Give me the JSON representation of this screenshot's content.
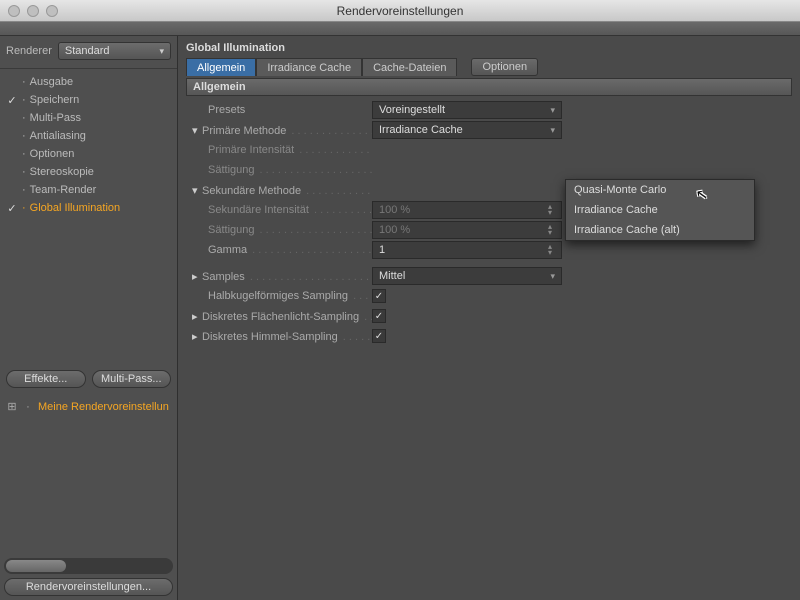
{
  "window": {
    "title": "Rendervoreinstellungen"
  },
  "sidebar": {
    "renderer_label": "Renderer",
    "renderer_value": "Standard",
    "items": [
      {
        "label": "Ausgabe",
        "checked": "",
        "indent": 0,
        "active": false,
        "dim": false
      },
      {
        "label": "Speichern",
        "checked": "✓",
        "indent": 0,
        "active": false,
        "dim": false
      },
      {
        "label": "Multi-Pass",
        "checked": "",
        "indent": 0,
        "active": false,
        "dim": false
      },
      {
        "label": "Antialiasing",
        "checked": "",
        "indent": 0,
        "active": false,
        "dim": false
      },
      {
        "label": "Optionen",
        "checked": "",
        "indent": 0,
        "active": false,
        "dim": false
      },
      {
        "label": "Stereoskopie",
        "checked": "",
        "indent": 0,
        "active": false,
        "dim": false
      },
      {
        "label": "Team-Render",
        "checked": "",
        "indent": 0,
        "active": false,
        "dim": false
      },
      {
        "label": "Global Illumination",
        "checked": "✓",
        "indent": 0,
        "active": true,
        "dim": false
      }
    ],
    "buttons": {
      "effects": "Effekte...",
      "multipass": "Multi-Pass..."
    },
    "preset_name": "Meine Rendervoreinstellun",
    "bottom_button": "Rendervoreinstellungen..."
  },
  "panel": {
    "title": "Global Illumination",
    "tabs": [
      "Allgemein",
      "Irradiance Cache",
      "Cache-Dateien",
      "Optionen"
    ],
    "section_header": "Allgemein",
    "presets_label": "Presets",
    "presets_value": "Voreingestellt",
    "rows": {
      "primary_method": {
        "label": "Primäre Methode",
        "value": "Irradiance Cache"
      },
      "primary_intensity": {
        "label": "Primäre Intensität"
      },
      "primary_saturation": {
        "label": "Sättigung"
      },
      "secondary_method": {
        "label": "Sekundäre Methode"
      },
      "secondary_intensity": {
        "label": "Sekundäre Intensität",
        "value": "100 %"
      },
      "secondary_saturation": {
        "label": "Sättigung",
        "value": "100 %"
      },
      "gamma": {
        "label": "Gamma",
        "value": "1"
      },
      "samples": {
        "label": "Samples",
        "value": "Mittel"
      },
      "hemispheric": {
        "label": "Halbkugelförmiges Sampling",
        "checked": "✓"
      },
      "area_light": {
        "label": "Diskretes Flächenlicht-Sampling",
        "checked": "✓"
      },
      "sky": {
        "label": "Diskretes Himmel-Sampling",
        "checked": "✓"
      }
    },
    "dropdown_options": [
      "Quasi-Monte Carlo",
      "Irradiance Cache",
      "Irradiance Cache (alt)"
    ]
  }
}
